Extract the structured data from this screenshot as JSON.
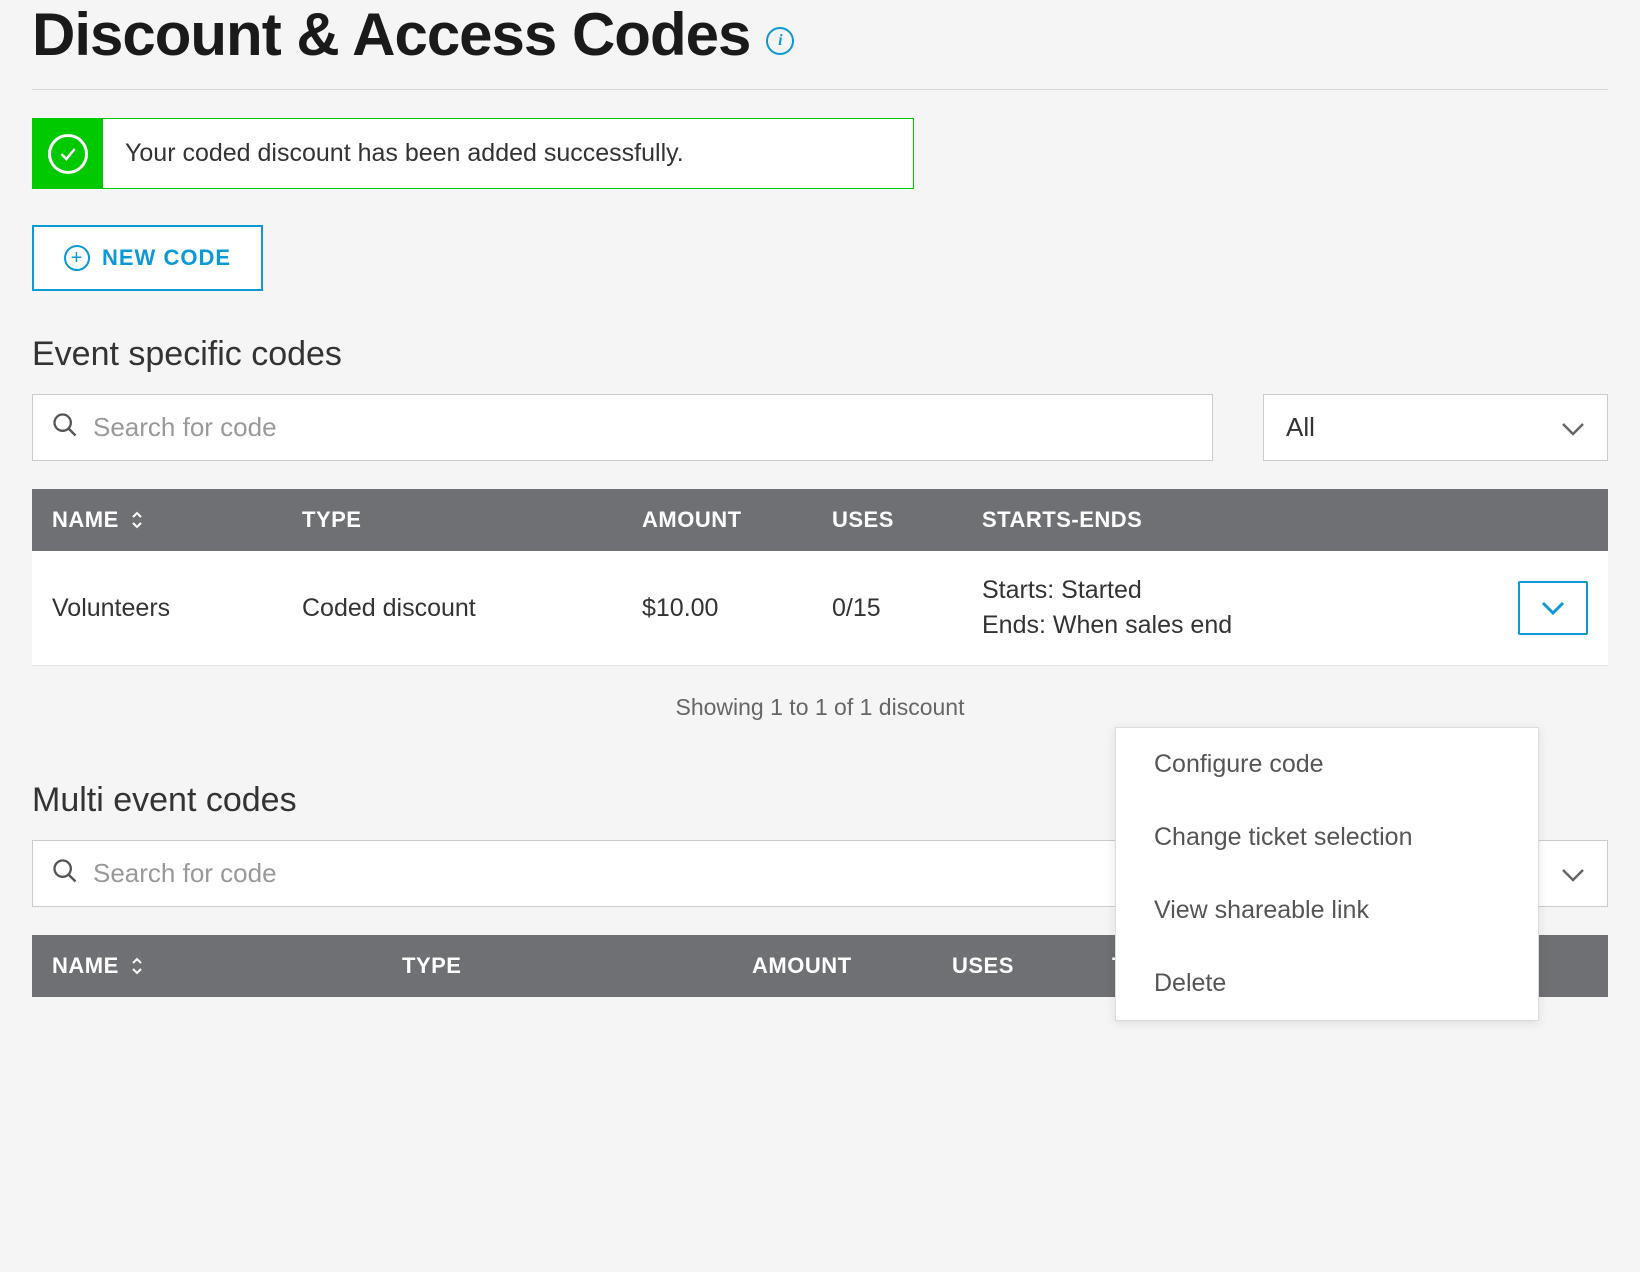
{
  "header": {
    "title": "Discount & Access Codes"
  },
  "alert": {
    "message": "Your coded discount has been added successfully."
  },
  "new_code_button": {
    "label": "NEW CODE"
  },
  "event_section": {
    "title": "Event specific codes",
    "search_placeholder": "Search for code",
    "filter_selected": "All",
    "columns": {
      "name": "NAME",
      "type": "TYPE",
      "amount": "AMOUNT",
      "uses": "USES",
      "starts_ends": "STARTS-ENDS"
    },
    "rows": [
      {
        "name": "Volunteers",
        "type": "Coded discount",
        "amount": "$10.00",
        "uses": "0/15",
        "starts": "Starts: Started",
        "ends": "Ends: When sales end"
      }
    ],
    "footer": "Showing 1 to 1 of 1 discount"
  },
  "row_menu": {
    "items": [
      "Configure code",
      "Change ticket selection",
      "View shareable link",
      "Delete"
    ]
  },
  "multi_section": {
    "title": "Multi event codes",
    "search_placeholder": "Search for code",
    "columns": {
      "name": "NAME",
      "type": "TYPE",
      "amount": "AMOUNT",
      "uses": "USES",
      "ticket_group": "TICKET GROUP"
    }
  }
}
